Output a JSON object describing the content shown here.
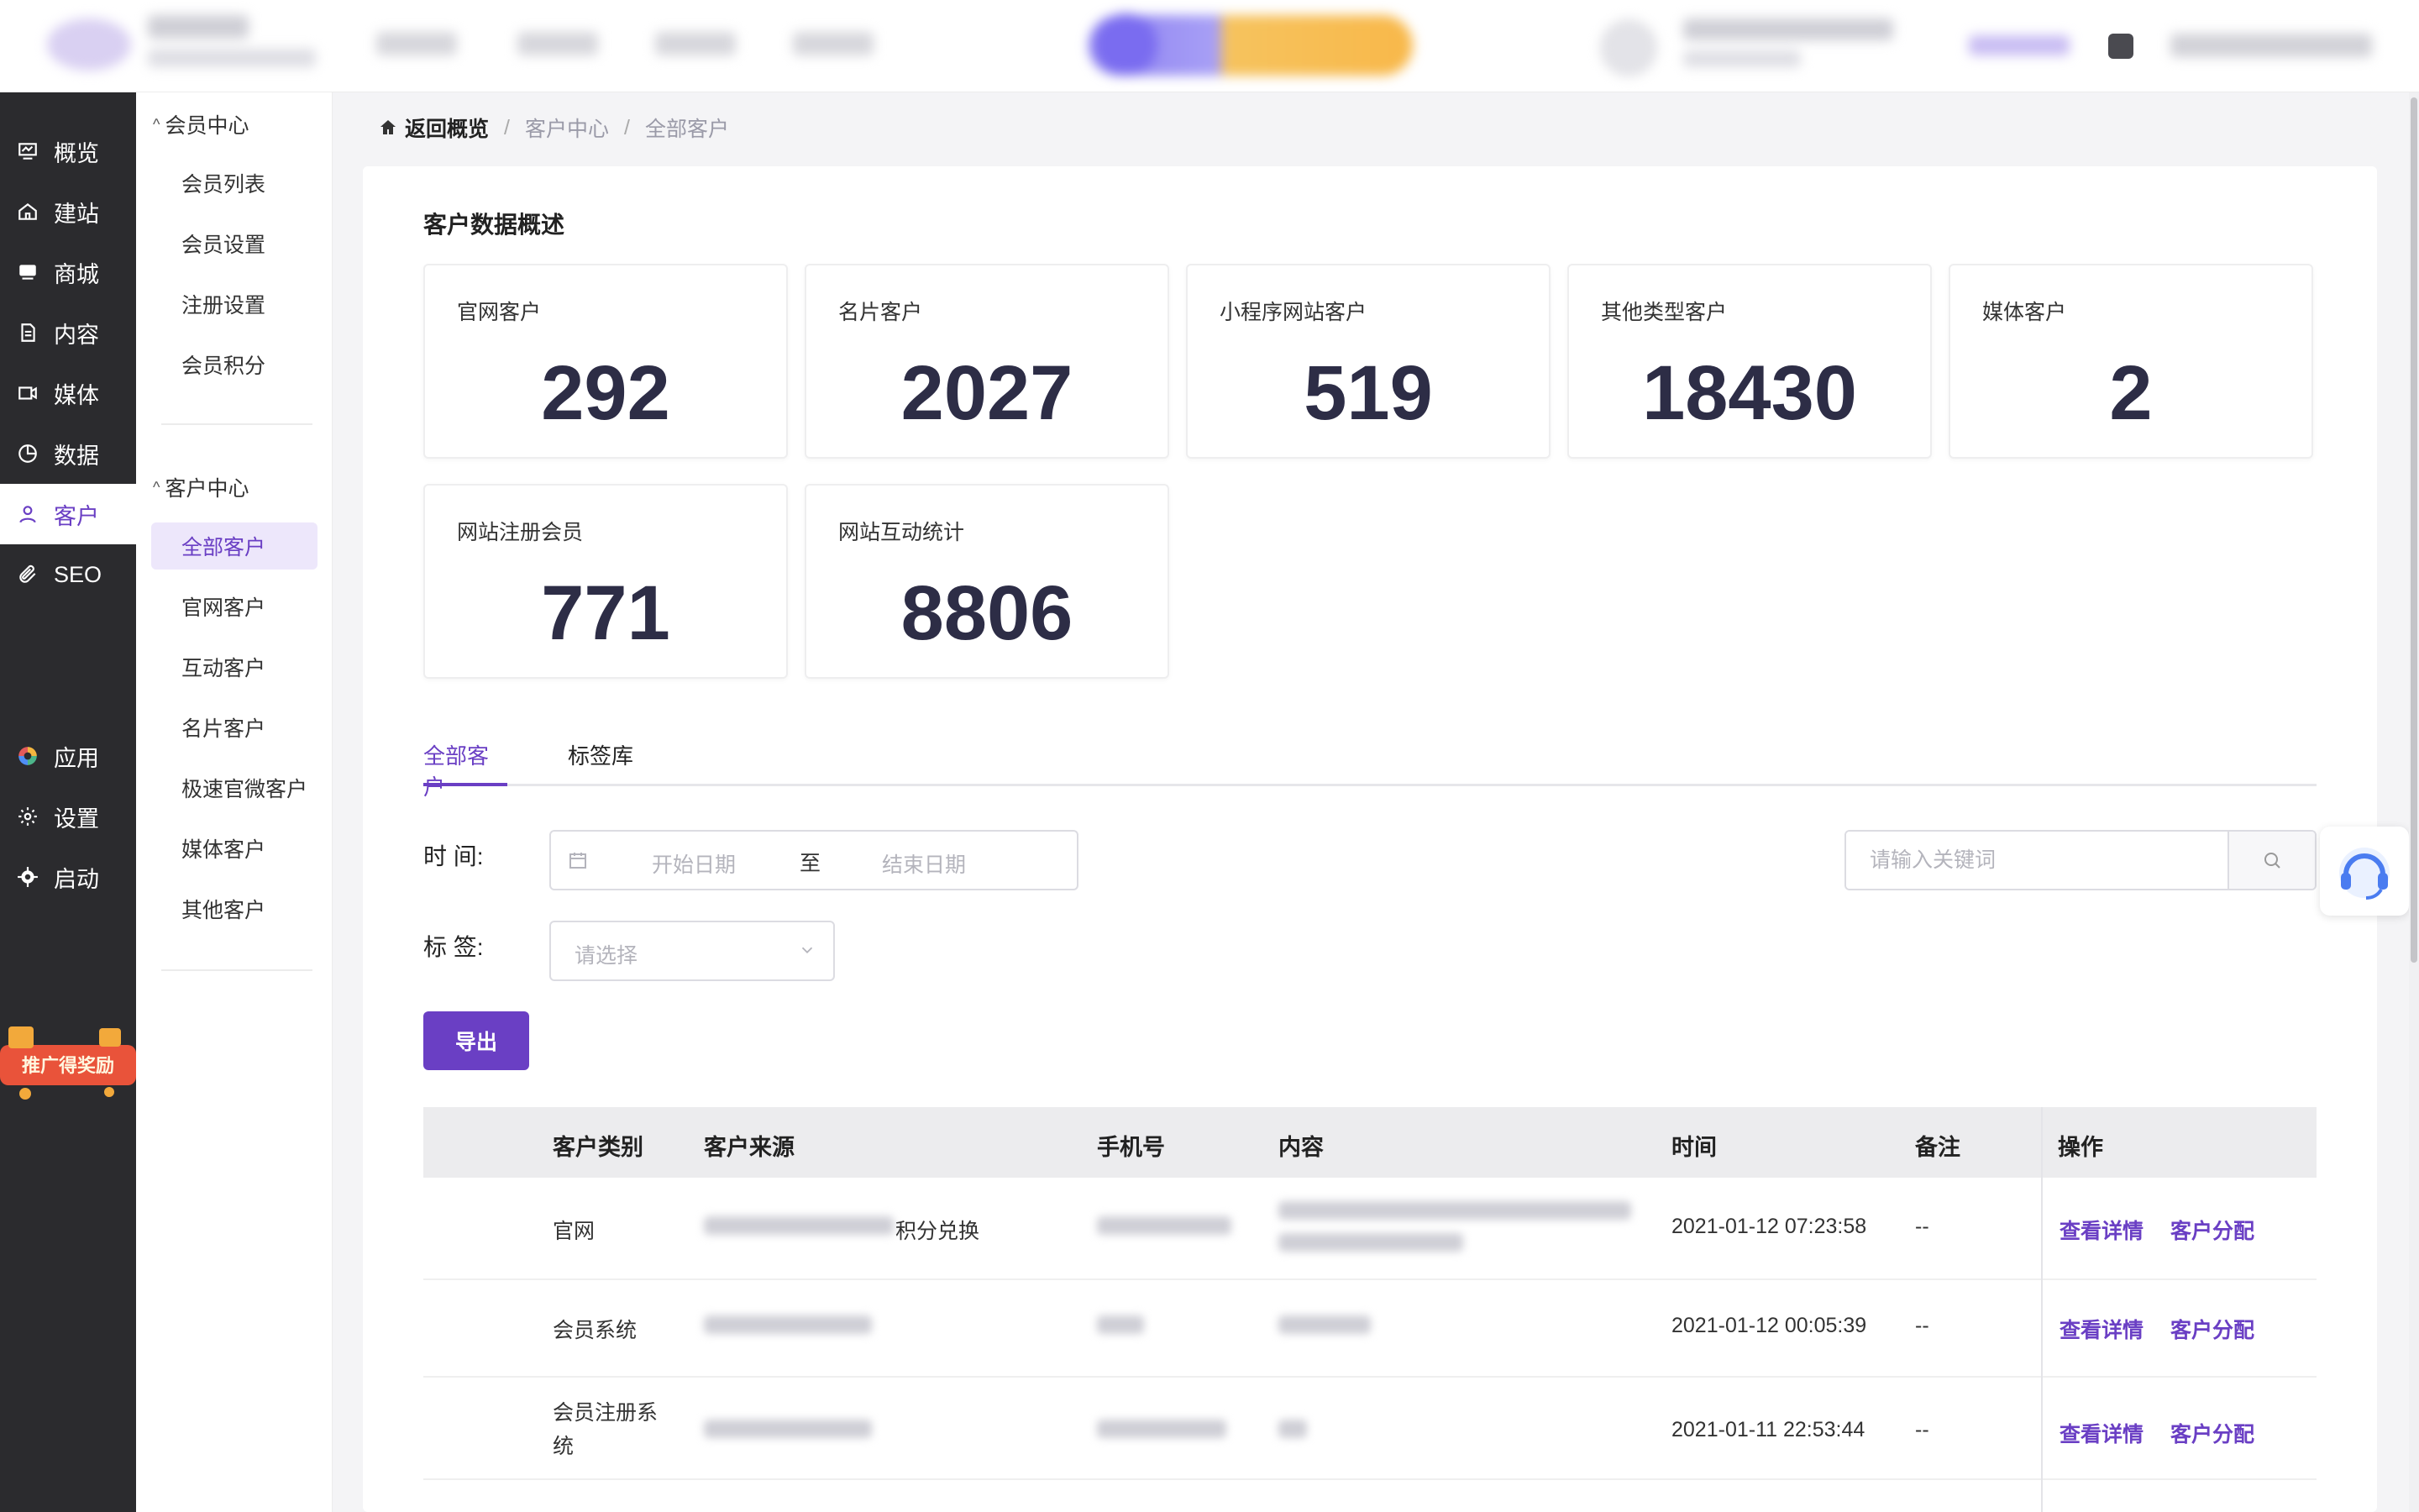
{
  "header": {
    "logo_text": "",
    "promo_text": ""
  },
  "leftnav": {
    "items": [
      {
        "label": "概览",
        "icon": "dashboard-icon"
      },
      {
        "label": "建站",
        "icon": "home-icon"
      },
      {
        "label": "商城",
        "icon": "store-icon"
      },
      {
        "label": "内容",
        "icon": "document-icon"
      },
      {
        "label": "媒体",
        "icon": "video-icon"
      },
      {
        "label": "数据",
        "icon": "pie-chart-icon"
      },
      {
        "label": "客户",
        "icon": "user-icon",
        "active": true
      },
      {
        "label": "SEO",
        "icon": "paperclip-icon"
      },
      {
        "label": "应用",
        "icon": "apps-icon"
      },
      {
        "label": "设置",
        "icon": "gear-icon"
      },
      {
        "label": "启动",
        "icon": "launch-gear-icon"
      }
    ],
    "promo_badge": "推广得奖励"
  },
  "subnav": {
    "member_group": "会员中心",
    "member_items": [
      "会员列表",
      "会员设置",
      "注册设置",
      "会员积分"
    ],
    "customer_group": "客户中心",
    "customer_items": [
      "全部客户",
      "官网客户",
      "互动客户",
      "名片客户",
      "极速官微客户",
      "媒体客户",
      "其他客户"
    ]
  },
  "breadcrumb": {
    "home": "返回概览",
    "level1": "客户中心",
    "level2": "全部客户",
    "separator": "/"
  },
  "overview": {
    "title": "客户数据概述",
    "stats": [
      {
        "label": "官网客户",
        "value": "292"
      },
      {
        "label": "名片客户",
        "value": "2027"
      },
      {
        "label": "小程序网站客户",
        "value": "519"
      },
      {
        "label": "其他类型客户",
        "value": "18430"
      },
      {
        "label": "媒体客户",
        "value": "2"
      },
      {
        "label": "网站注册会员",
        "value": "771"
      },
      {
        "label": "网站互动统计",
        "value": "8806"
      }
    ]
  },
  "tabs": [
    "全部客户",
    "标签库"
  ],
  "filters": {
    "time_label": "时  间:",
    "start_placeholder": "开始日期",
    "to": "至",
    "end_placeholder": "结束日期",
    "tag_label": "标  签:",
    "tag_placeholder": "请选择",
    "search_placeholder": "请输入关键词",
    "export_label": "导出"
  },
  "table": {
    "headers": [
      "客户类别",
      "客户来源",
      "手机号",
      "内容",
      "时间",
      "备注",
      "操作"
    ],
    "rows": [
      {
        "type": "官网",
        "source_suffix": "积分兑换",
        "time": "2021-01-12 07:23:58",
        "note": "--"
      },
      {
        "type": "会员系统",
        "source_suffix": "",
        "time": "2021-01-12 00:05:39",
        "note": "--"
      },
      {
        "type": "会员注册系统",
        "source_suffix": "",
        "time": "2021-01-11 22:53:44",
        "note": "--"
      }
    ],
    "action_detail": "查看详情",
    "action_assign": "客户分配"
  },
  "colors": {
    "accent": "#6a3fc4",
    "nav_dark": "#2b2b2e",
    "stat_value": "#2d2d46"
  }
}
